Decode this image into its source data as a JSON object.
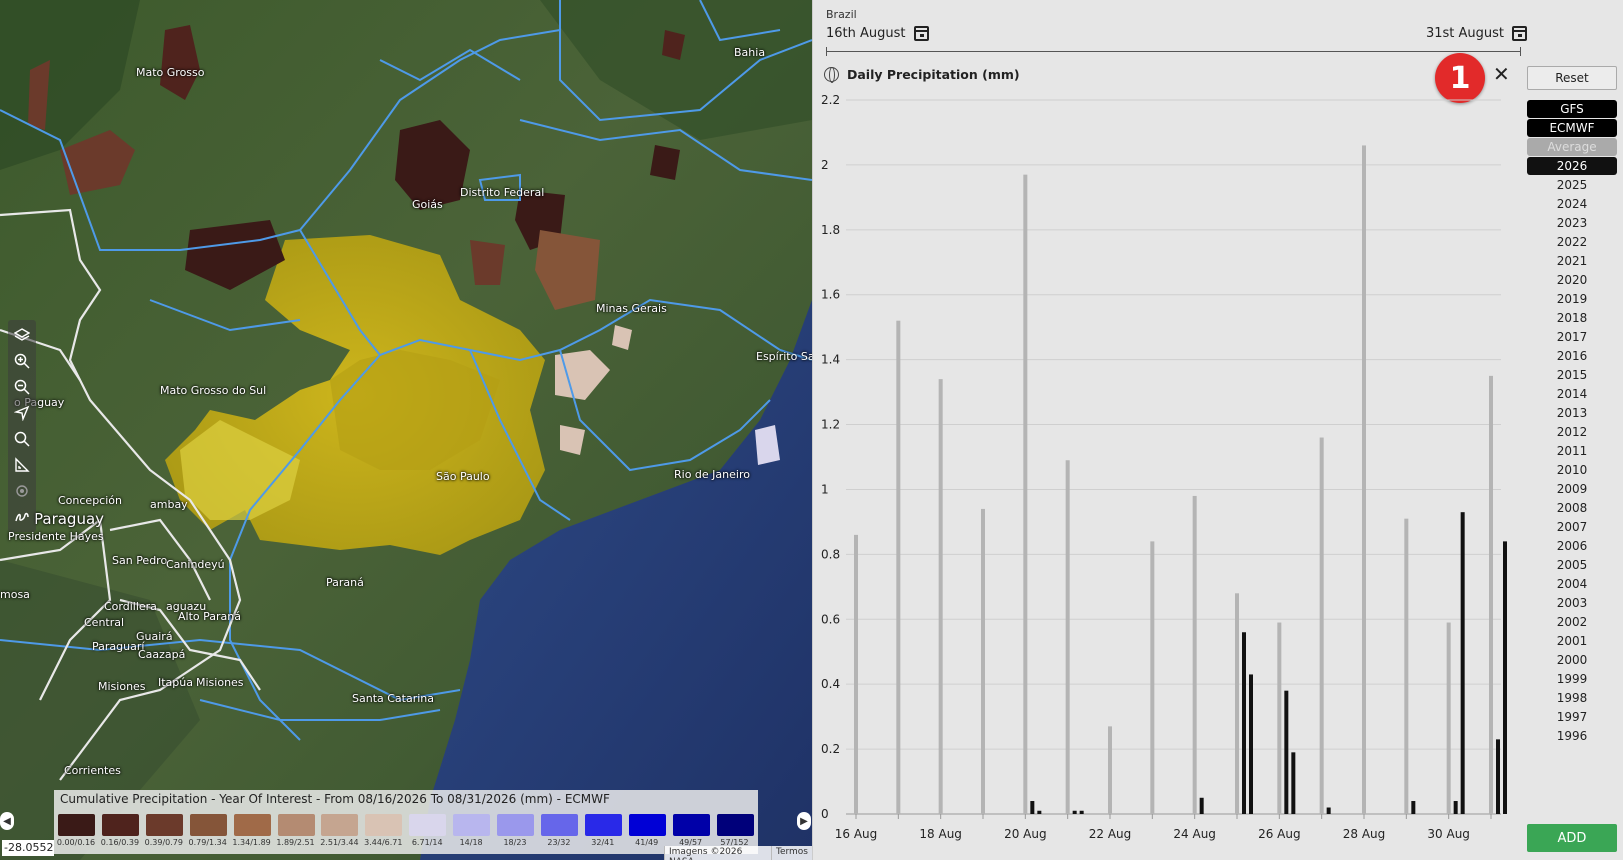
{
  "map": {
    "labels": {
      "mato_grosso": "Mato Grosso",
      "bahia": "Bahia",
      "goias": "Goiás",
      "distrito_federal": "Distrito Federal",
      "minas_gerais": "Minas Gerais",
      "espirito_santo": "Espírito Sa",
      "mato_grosso_do_sul": "Mato Grosso do Sul",
      "paraguay_small": "o Paguay",
      "paraguay": "Paraguay",
      "presidente_hayes": "Presidente Hayes",
      "sao_paulo": "São Paulo",
      "rio_de_janeiro": "Rio de Janeiro",
      "concepcion": "Concepción",
      "amambay": "ambay",
      "san_pedro": "San Pedro",
      "canindeyu": "Canindeyú",
      "parana": "Paraná",
      "mosa": "mosa",
      "cordillera": "Cordillera",
      "caaguazu": "aguazu",
      "central": "Central",
      "alto_parana": "Alto Paraná",
      "guaira": "Guairá",
      "paraguari": "Paraguarí",
      "caazapa": "Caazapá",
      "misiones": "Misiones",
      "itapua": "Itapúa",
      "misiones2": "Misiones",
      "santa_catarina": "Santa Catarina",
      "corrientes": "Corrientes"
    },
    "toolbar": [
      "layers-icon",
      "zoom-in-icon",
      "zoom-out-icon",
      "navigate-icon",
      "search-icon",
      "measure-icon",
      "locate-icon",
      "draw-icon"
    ],
    "legend": {
      "title": "Cumulative Precipitation - Year Of Interest - From 08/16/2026 To 08/31/2026 (mm) - ECMWF",
      "bins": [
        {
          "label": "0.00/0.16",
          "color": "#3a1a17"
        },
        {
          "label": "0.16/0.39",
          "color": "#4f231d"
        },
        {
          "label": "0.39/0.79",
          "color": "#6b3a2b"
        },
        {
          "label": "0.79/1.34",
          "color": "#855539"
        },
        {
          "label": "1.34/1.89",
          "color": "#a06a48"
        },
        {
          "label": "1.89/2.51",
          "color": "#b48b72"
        },
        {
          "label": "2.51/3.44",
          "color": "#c5a590"
        },
        {
          "label": "3.44/6.71",
          "color": "#d9c3b4"
        },
        {
          "label": "6.71/14",
          "color": "#d9d6ec"
        },
        {
          "label": "14/18",
          "color": "#b8b6ee"
        },
        {
          "label": "18/23",
          "color": "#9a98ec"
        },
        {
          "label": "23/32",
          "color": "#6666ea"
        },
        {
          "label": "32/41",
          "color": "#2929e8"
        },
        {
          "label": "41/49",
          "color": "#0000d6"
        },
        {
          "label": "49/57",
          "color": "#0000a8"
        },
        {
          "label": "57/152",
          "color": "#00007a"
        }
      ]
    },
    "coordinate": "-28.0552",
    "attribution": [
      "Imagens ©2026 NASA",
      "Termos"
    ]
  },
  "panel": {
    "region": "Brazil",
    "start_date": "16th August",
    "end_date": "31st August",
    "chart_title": "Daily Precipitation (mm)",
    "badge": "1",
    "close": "✕",
    "reset_label": "Reset",
    "models": [
      "GFS",
      "ECMWF",
      "Average"
    ],
    "years": [
      "2026",
      "2025",
      "2024",
      "2023",
      "2022",
      "2021",
      "2020",
      "2019",
      "2018",
      "2017",
      "2016",
      "2015",
      "2014",
      "2013",
      "2012",
      "2011",
      "2010",
      "2009",
      "2008",
      "2007",
      "2006",
      "2005",
      "2004",
      "2003",
      "2002",
      "2001",
      "2000",
      "1999",
      "1998",
      "1997",
      "1996"
    ],
    "active_year": "2026",
    "add_label": "ADD"
  },
  "chart_data": {
    "type": "bar",
    "title": "Daily Precipitation (mm)",
    "ylim": [
      0,
      2.2
    ],
    "yticks": [
      "0",
      "0.2",
      "0.4",
      "0.6",
      "0.8",
      "1",
      "1.2",
      "1.4",
      "1.6",
      "1.8",
      "2",
      "2.2"
    ],
    "xtick_labels": [
      "16 Aug",
      "18 Aug",
      "20 Aug",
      "22 Aug",
      "24 Aug",
      "26 Aug",
      "28 Aug",
      "30 Aug"
    ],
    "categories": [
      "16 Aug",
      "17 Aug",
      "18 Aug",
      "19 Aug",
      "20 Aug",
      "21 Aug",
      "22 Aug",
      "23 Aug",
      "24 Aug",
      "25 Aug",
      "26 Aug",
      "27 Aug",
      "28 Aug",
      "29 Aug",
      "30 Aug",
      "31 Aug"
    ],
    "series": [
      {
        "color": "#b4b4b4",
        "values": [
          0.86,
          1.52,
          1.34,
          0.94,
          1.97,
          1.09,
          0.27,
          0.84,
          0.98,
          0.68,
          0.59,
          1.16,
          2.06,
          0.91,
          0.59,
          1.35
        ]
      },
      {
        "color": "#111111",
        "values": [
          0,
          0,
          0,
          0,
          0.04,
          0.01,
          0,
          0,
          0.05,
          0.56,
          0.38,
          0.02,
          0,
          0.04,
          0.04,
          0.23
        ]
      },
      {
        "color": "#111111",
        "values": [
          0,
          0,
          0,
          0,
          0.01,
          0.01,
          0,
          0,
          0,
          0.43,
          0.19,
          0,
          0,
          0,
          0.93,
          0.84
        ]
      }
    ]
  }
}
